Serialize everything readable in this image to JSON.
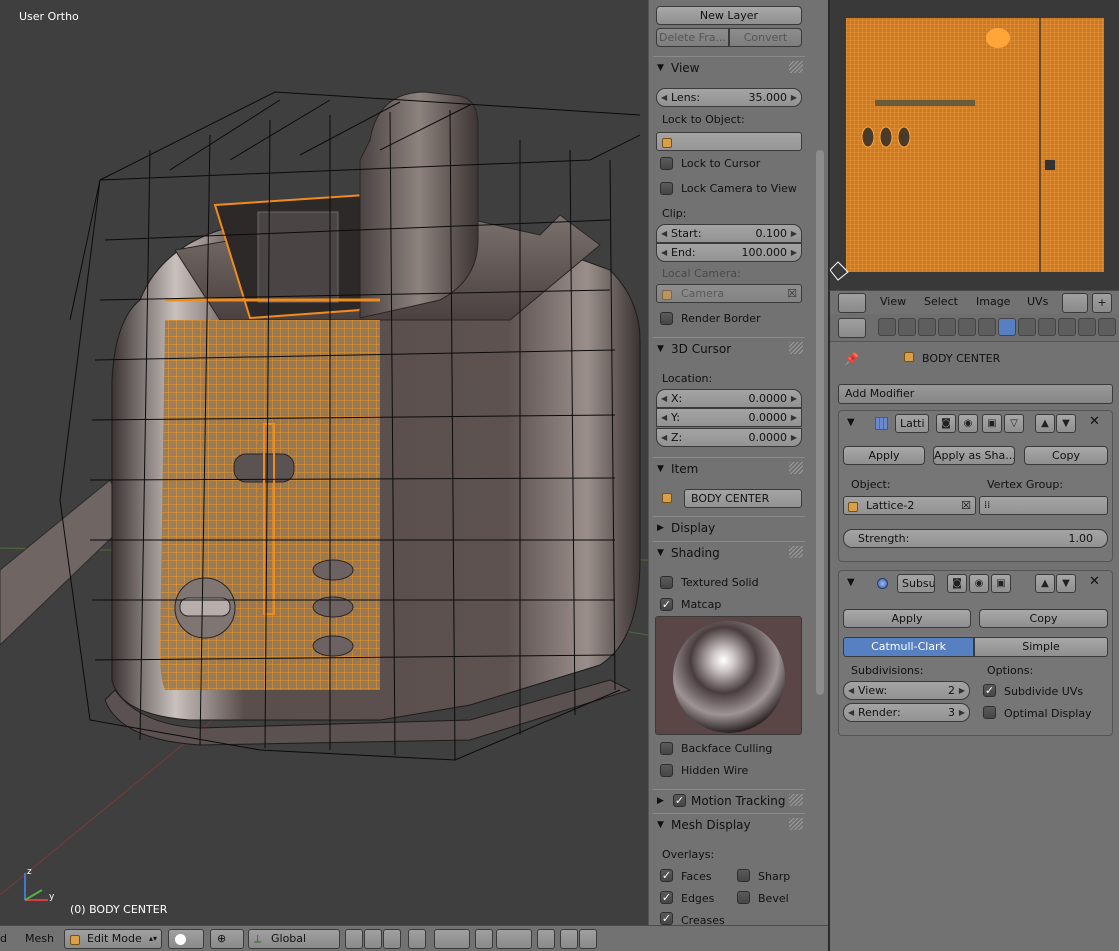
{
  "viewport": {
    "title": "User Ortho",
    "status": "(0) BODY CENTER"
  },
  "npanel": {
    "new_layer": "New Layer",
    "delete_frame": "Delete Fra...",
    "convert": "Convert",
    "view": {
      "title": "View",
      "lens_label": "Lens:",
      "lens_value": "35.000",
      "lock_to_object": "Lock to Object:",
      "lock_to_cursor": "Lock to Cursor",
      "lock_camera": "Lock Camera to View",
      "clip": "Clip:",
      "start_label": "Start:",
      "start_value": "0.100",
      "end_label": "End:",
      "end_value": "100.000",
      "local_camera": "Local Camera:",
      "camera_placeholder": "Camera",
      "render_border": "Render Border"
    },
    "cursor": {
      "title": "3D Cursor",
      "location": "Location:",
      "x_label": "X:",
      "x_value": "0.0000",
      "y_label": "Y:",
      "y_value": "0.0000",
      "z_label": "Z:",
      "z_value": "0.0000"
    },
    "item": {
      "title": "Item",
      "name": "BODY CENTER"
    },
    "display": {
      "title": "Display"
    },
    "shading": {
      "title": "Shading",
      "textured_solid": "Textured Solid",
      "matcap": "Matcap",
      "backface_culling": "Backface Culling",
      "hidden_wire": "Hidden Wire"
    },
    "motion_tracking": {
      "title": "Motion Tracking"
    },
    "mesh_display": {
      "title": "Mesh Display",
      "overlays": "Overlays:",
      "faces": "Faces",
      "sharp": "Sharp",
      "edges": "Edges",
      "bevel": "Bevel",
      "creases": "Creases"
    }
  },
  "uv_header": {
    "view": "View",
    "select": "Select",
    "image": "Image",
    "uvs": "UVs"
  },
  "properties": {
    "breadcrumb": "BODY CENTER",
    "add_modifier": "Add Modifier",
    "lattice_mod": {
      "name": "Latti",
      "apply": "Apply",
      "apply_as_shape": "Apply as Sha...",
      "copy": "Copy",
      "object_label": "Object:",
      "object_value": "Lattice-2",
      "vertex_group_label": "Vertex Group:",
      "strength_label": "Strength:",
      "strength_value": "1.00"
    },
    "subsurf_mod": {
      "name": "Subsu",
      "apply": "Apply",
      "copy": "Copy",
      "catmull": "Catmull-Clark",
      "simple": "Simple",
      "subdivisions": "Subdivisions:",
      "options": "Options:",
      "view_label": "View:",
      "view_value": "2",
      "render_label": "Render:",
      "render_value": "3",
      "subdivide_uvs": "Subdivide UVs",
      "optimal_display": "Optimal Display"
    }
  },
  "bottombar": {
    "d": "d",
    "mesh": "Mesh",
    "mode": "Edit Mode",
    "orientation": "Global"
  },
  "colors": {
    "selection": "#f08c1c",
    "active_blue": "#5680c2",
    "panel": "#727272"
  }
}
